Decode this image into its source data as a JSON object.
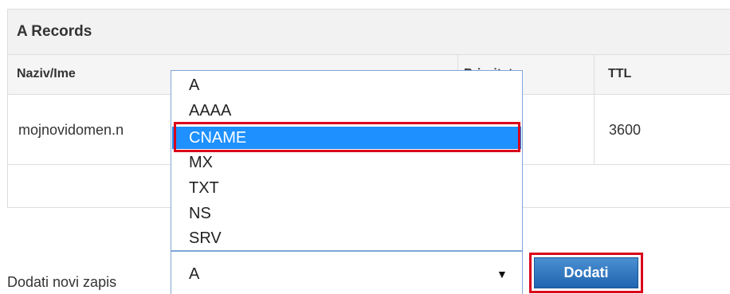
{
  "panel": {
    "title": "A Records"
  },
  "table": {
    "columns": [
      "Naziv/Ime",
      "Prioritet",
      "TTL"
    ],
    "rows": [
      {
        "name": "mojnovidomen.n",
        "ttl": "3600"
      }
    ]
  },
  "add_record": {
    "label": "Dodati novi zapis",
    "select_value": "A",
    "options": [
      "A",
      "AAAA",
      "CNAME",
      "MX",
      "TXT",
      "NS",
      "SRV"
    ],
    "highlighted_option": "CNAME",
    "button_label": "Dodati",
    "arrow": "▼"
  },
  "colors": {
    "highlight_border": "#d9001b",
    "selected_option_bg": "#1e90ff",
    "button_blue": "#1f65b0"
  }
}
